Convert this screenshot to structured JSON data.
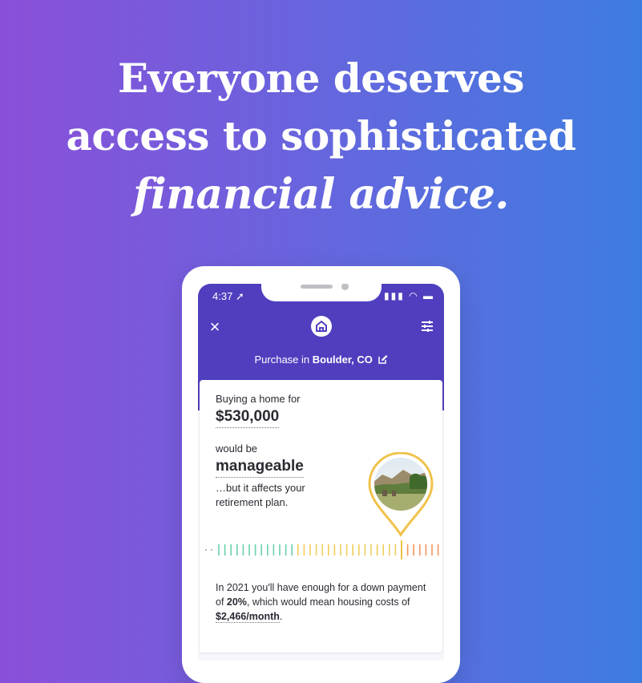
{
  "headline": {
    "line1": "Everyone deserves",
    "line2": "access to sophisticated",
    "line3": "financial advice."
  },
  "status_bar": {
    "time": "4:37 ➚"
  },
  "nav": {
    "close_icon": "close-icon",
    "home_icon": "home-icon",
    "filters_icon": "sliders-icon"
  },
  "location": {
    "prefix": "Purchase in",
    "place": "Boulder, CO"
  },
  "card": {
    "intro": "Buying a home for",
    "price": "$530,000",
    "would_be": "would be",
    "assessment": "manageable",
    "affects_line1": "…but it affects your",
    "affects_line2": "retirement plan.",
    "summary": {
      "part1": "In 2021 you'll have enough for a down payment of ",
      "percent": "20%",
      "part2": ", which would mean housing costs of ",
      "monthly": "$2,466/month",
      "part3": "."
    }
  },
  "colors": {
    "header": "#4f3fbf",
    "pin": "#f0c24a",
    "tick_green": "#6bd0a8",
    "tick_yellow": "#f2cd5b",
    "tick_orange": "#f2945c"
  }
}
